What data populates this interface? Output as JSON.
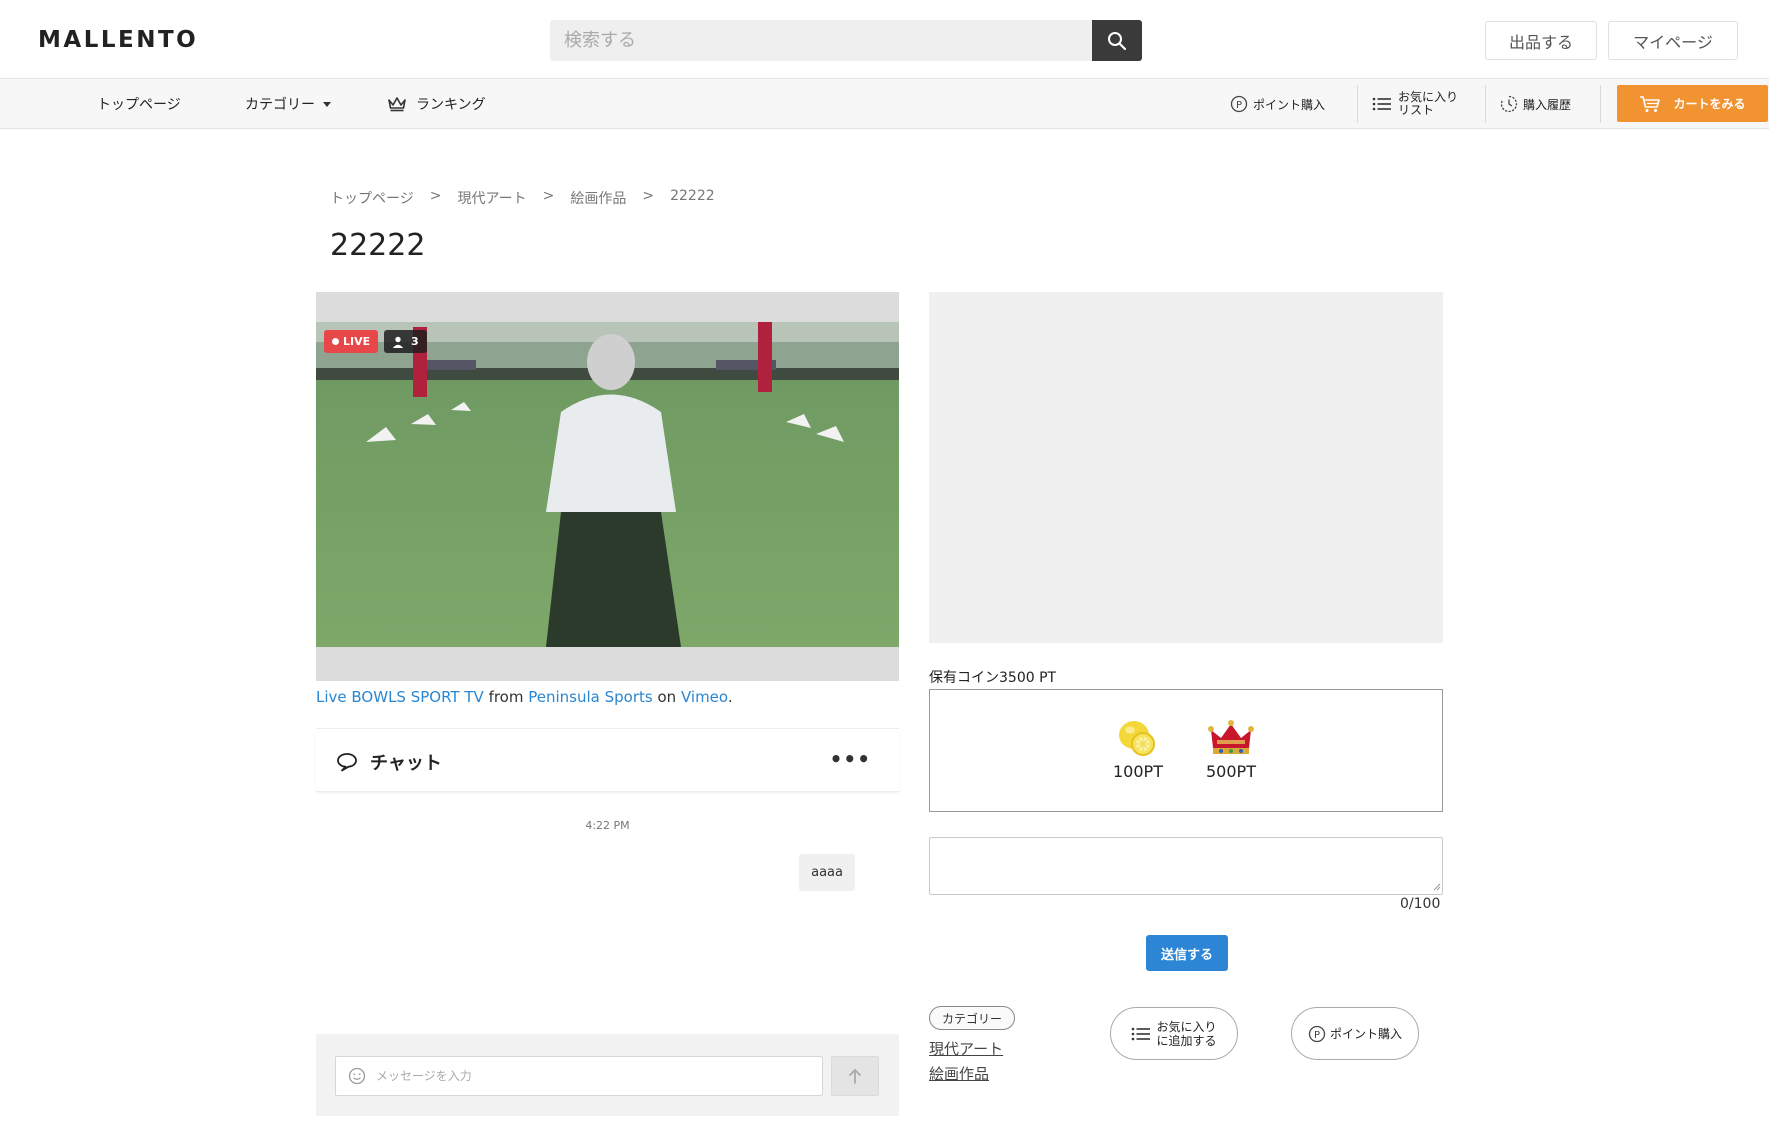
{
  "header": {
    "logo": "MALLENTO",
    "search_placeholder": "検索する",
    "sell_label": "出品する",
    "mypage_label": "マイページ"
  },
  "nav": {
    "top_label": "トップページ",
    "category_label": "カテゴリー",
    "ranking_label": "ランキング",
    "points_label": "ポイント購入",
    "favorites_line1": "お気に入り",
    "favorites_line2": "リスト",
    "history_label": "購入履歴",
    "cart_label": "カートをみる"
  },
  "breadcrumb": [
    "トップページ",
    "現代アート",
    "絵画作品",
    "22222"
  ],
  "breadcrumb_sep": ">",
  "page_title": "22222",
  "video": {
    "live_label": "LIVE",
    "viewer_count": "3",
    "caption": {
      "link1": "Live BOWLS SPORT TV",
      "from": "from",
      "link2": "Peninsula Sports",
      "on": "on",
      "link3": "Vimeo",
      "end": "."
    }
  },
  "chat": {
    "title": "チャット",
    "more": "•••",
    "time": "4:22 PM",
    "message": "aaaa",
    "input_placeholder": "メッセージを入力"
  },
  "coins": {
    "label": "保有コイン3500 PT",
    "gifts": [
      {
        "label": "100PT",
        "icon": "lemon-icon"
      },
      {
        "label": "500PT",
        "icon": "crown-icon"
      }
    ]
  },
  "message_box": {
    "char_count": "0/100",
    "submit_label": "送信する"
  },
  "category": {
    "tag": "カテゴリー",
    "links": [
      "現代アート",
      "絵画作品"
    ]
  },
  "actions": {
    "fav_line1": "お気に入り",
    "fav_line2": "に追加する",
    "points_label": "ポイント購入"
  },
  "colors": {
    "accent_orange": "#f29331",
    "link_blue": "#2a86d0",
    "submit_blue": "#2c86d5",
    "live_red": "#e8474a"
  }
}
